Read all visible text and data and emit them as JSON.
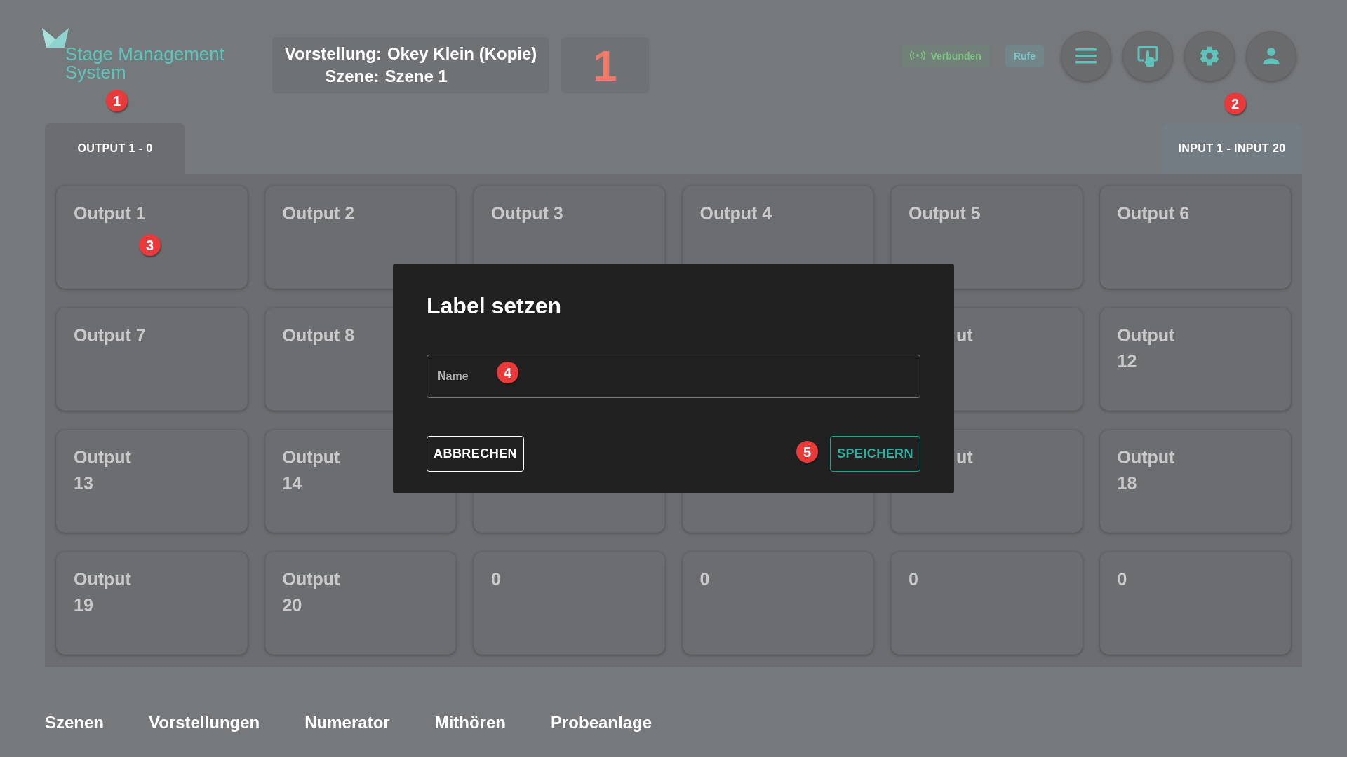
{
  "logo": {
    "text": "Stage Management System"
  },
  "header": {
    "performance_label": "Vorstellung:",
    "performance": "Okey Klein (Kopie)",
    "scene_label": "Szene:",
    "scene": "Szene 1",
    "counter": "1",
    "status": [
      {
        "kind": "connection",
        "label": "Verbunden"
      },
      {
        "kind": "call",
        "label": "Rufe"
      }
    ],
    "buttons": [
      {
        "kind": "menu"
      },
      {
        "kind": "touch"
      },
      {
        "kind": "settings"
      },
      {
        "kind": "user"
      }
    ]
  },
  "tabs": [
    {
      "label": "OUTPUT 1 - 0",
      "selected": true
    },
    {
      "label": "INPUT 1 - INPUT 20",
      "selected": false
    }
  ],
  "grid": {
    "rows": [
      [
        {
          "label": "Output 1"
        },
        {
          "label": "Output 2"
        },
        {
          "label": "Output 3"
        },
        {
          "label": "Output 4"
        },
        {
          "label": "Output 5"
        },
        {
          "label": "Output 6"
        }
      ],
      [
        {
          "label": "Output 7"
        },
        {
          "label": "Output 8"
        },
        {
          "kind": "hidden"
        },
        {
          "kind": "hidden"
        },
        {
          "kind": "partial",
          "label": "ut"
        },
        {
          "label": "Output 12"
        }
      ],
      [
        {
          "label": "Output 13"
        },
        {
          "label": "Output 14"
        },
        {
          "kind": "covered"
        },
        {
          "kind": "covered"
        },
        {
          "kind": "partial",
          "label": "ut"
        },
        {
          "label": "Output 18"
        }
      ],
      [
        {
          "label": "Output 19"
        },
        {
          "label": "Output 20"
        },
        {
          "label": "0"
        },
        {
          "label": "0"
        },
        {
          "label": "0"
        },
        {
          "label": "0"
        }
      ]
    ]
  },
  "dialog": {
    "title": "Label setzen",
    "field": {
      "placeholder": "Name"
    },
    "cancel": "ABBRECHEN",
    "save": "SPEICHERN"
  },
  "nav": [
    "Szenen",
    "Vorstellungen",
    "Numerator",
    "Mithören",
    "Probeanlage"
  ],
  "callouts": [
    "1",
    "2",
    "3",
    "4",
    "5"
  ]
}
